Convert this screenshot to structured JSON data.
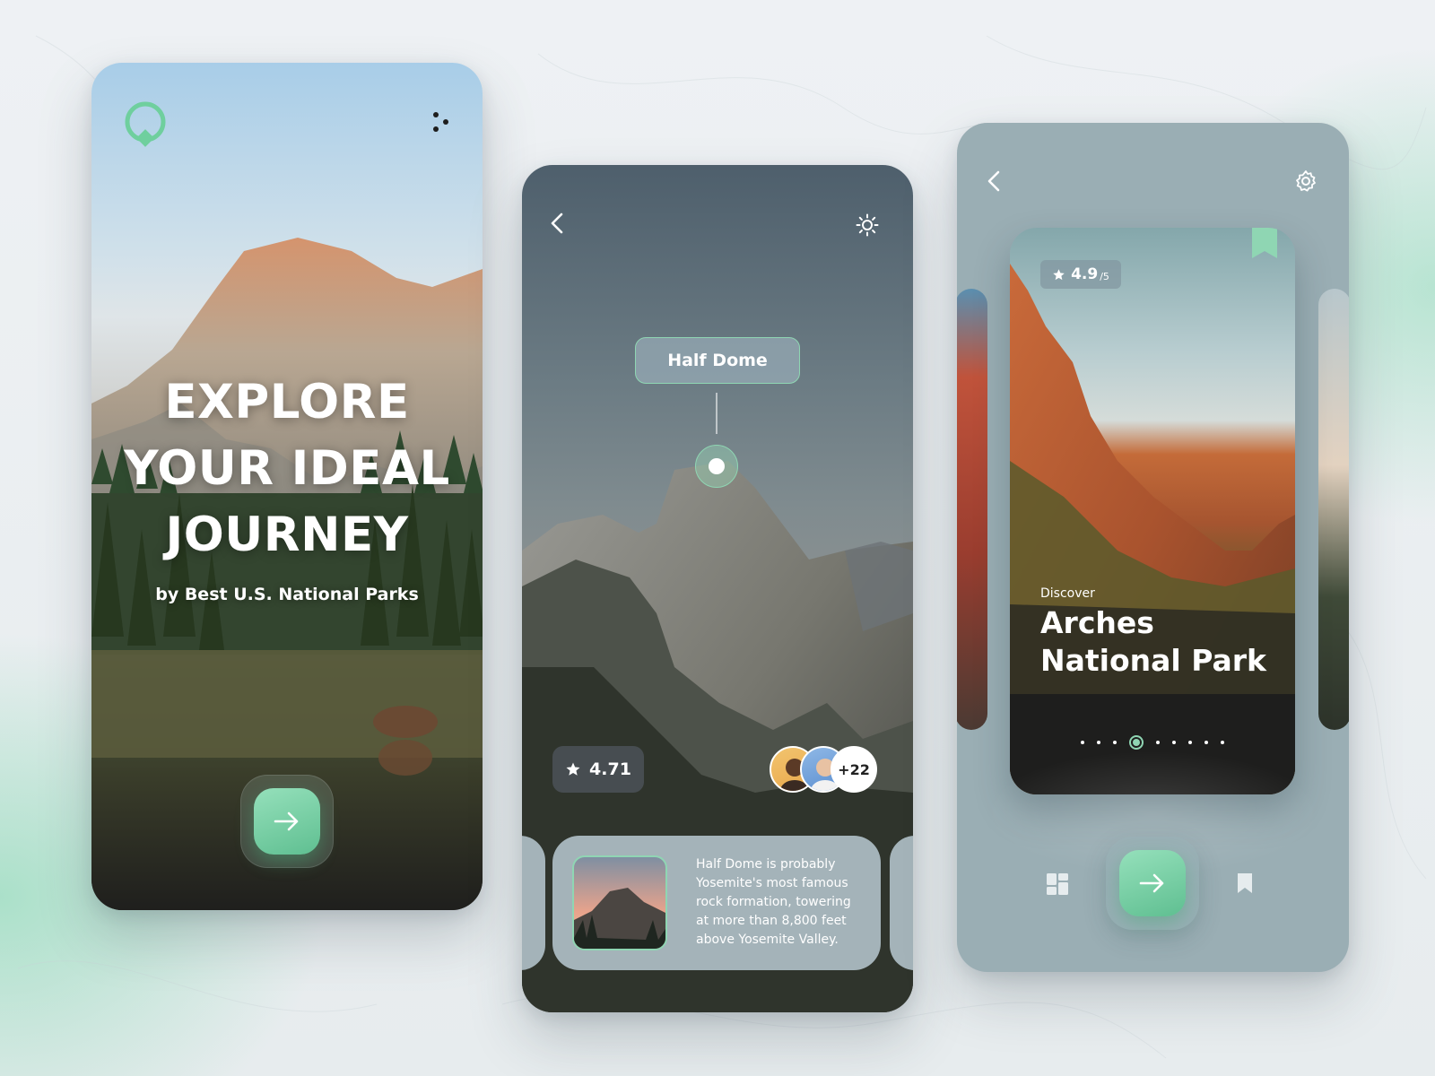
{
  "phone1": {
    "title_lines": [
      "EXPLORE",
      "YOUR IDEAL",
      "JOURNEY"
    ],
    "subtitle": "by Best U.S. National Parks",
    "icons": {
      "logo": "location-pin-logo",
      "menu": "dots-menu-icon",
      "next": "arrow-right-icon"
    }
  },
  "phone2": {
    "pin_label": "Half Dome",
    "rating": "4.71",
    "avatars_more": "+22",
    "description": "Half Dome is probably Yosemite's most famous rock formation, towering at more than 8,800 feet above Yosemite Valley.",
    "icons": {
      "back": "chevron-left-icon",
      "theme": "sun-icon",
      "star": "star-icon"
    }
  },
  "phone3": {
    "rating": "4.9",
    "rating_scale": "/5",
    "discover": "Discover",
    "park_name": "Arches National Park",
    "pager": {
      "total": 9,
      "active": 3
    },
    "icons": {
      "back": "chevron-left-icon",
      "settings": "gear-icon",
      "grid": "grid-icon",
      "bookmark": "bookmark-icon",
      "next": "arrow-right-icon"
    }
  },
  "colors": {
    "accent": "#7ed3a8",
    "accent_dark": "#5fbf91",
    "card_gray": "#9aaeb4",
    "background": "#eef1f4"
  }
}
